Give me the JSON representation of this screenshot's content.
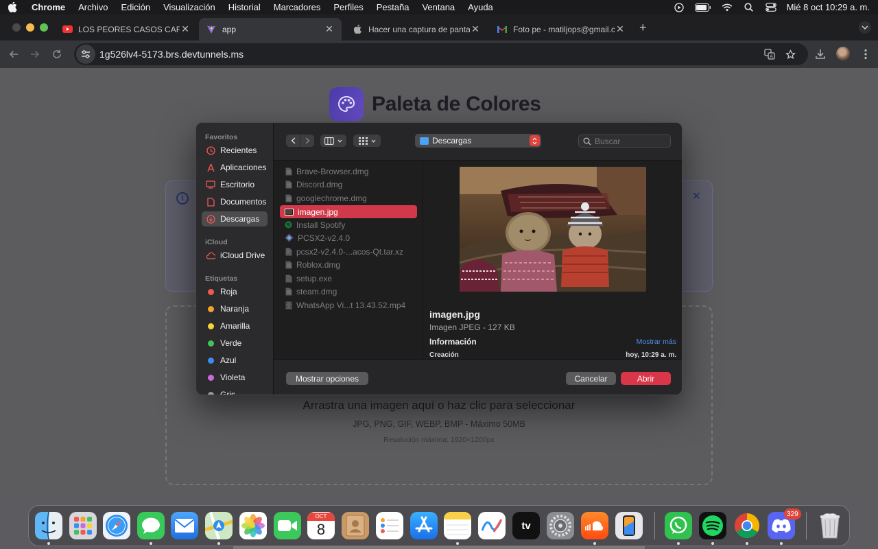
{
  "menubar": {
    "app": "Chrome",
    "items": [
      "Archivo",
      "Edición",
      "Visualización",
      "Historial",
      "Marcadores",
      "Perfiles",
      "Pestaña",
      "Ventana",
      "Ayuda"
    ],
    "clock": "Mié 8 oct 10:29 a. m."
  },
  "browser": {
    "tabs": [
      {
        "title": "LOS PEORES CASOS CAPTADOS",
        "icon": "youtube-icon"
      },
      {
        "title": "app",
        "icon": "vite-icon"
      },
      {
        "title": "Hacer una captura de pantalla",
        "icon": "apple-icon"
      },
      {
        "title": "Foto pe - matiljops@gmail.com",
        "icon": "gmail-icon"
      }
    ],
    "active_tab": 1,
    "url": "1g526lv4-5173.brs.devtunnels.ms"
  },
  "page": {
    "title": "Paleta de Colores",
    "dropzone_title": "Arrastra una imagen aquí o haz clic para seleccionar",
    "dropzone_formats": "JPG, PNG, GIF, WEBP, BMP - Máximo 50MB",
    "dropzone_note": "Resolución máxima: 1920×1200px"
  },
  "dialog": {
    "sidebar": {
      "favorites_label": "Favoritos",
      "favorites": [
        "Recientes",
        "Aplicaciones",
        "Escritorio",
        "Documentos",
        "Descargas"
      ],
      "selected": "Descargas",
      "icloud_label": "iCloud",
      "icloud": [
        "iCloud Drive"
      ],
      "tags_label": "Etiquetas",
      "tags": [
        {
          "name": "Roja",
          "color": "#f05a55"
        },
        {
          "name": "Naranja",
          "color": "#f4a033"
        },
        {
          "name": "Amarilla",
          "color": "#f5d33a"
        },
        {
          "name": "Verde",
          "color": "#43c15a"
        },
        {
          "name": "Azul",
          "color": "#3b8ef0"
        },
        {
          "name": "Violeta",
          "color": "#c86ad8"
        },
        {
          "name": "Gris",
          "color": "#9a9a9c"
        }
      ]
    },
    "location": "Descargas",
    "search_placeholder": "Buscar",
    "files": [
      {
        "name": "Brave-Browser.dmg",
        "icon": "disk-image-icon"
      },
      {
        "name": "Discord.dmg",
        "icon": "disk-image-icon"
      },
      {
        "name": "googlechrome.dmg",
        "icon": "disk-image-icon"
      },
      {
        "name": "imagen.jpg",
        "icon": "image-file-icon",
        "selected": true
      },
      {
        "name": "Install Spotify",
        "icon": "spotify-icon"
      },
      {
        "name": "PCSX2-v2.4.0",
        "icon": "app-icon"
      },
      {
        "name": "pcsx2-v2.4.0-...acos-Qt.tar.xz",
        "icon": "archive-icon"
      },
      {
        "name": "Roblox.dmg",
        "icon": "disk-image-icon"
      },
      {
        "name": "setup.exe",
        "icon": "document-icon"
      },
      {
        "name": "steam.dmg",
        "icon": "disk-image-icon"
      },
      {
        "name": "WhatsApp Vi...t 13.43.52.mp4",
        "icon": "video-file-icon"
      }
    ],
    "preview": {
      "name": "imagen.jpg",
      "kind": "Imagen JPEG - 127 KB",
      "info_label": "Información",
      "more_label": "Mostrar más",
      "created_label": "Creación",
      "created_value": "hoy, 10:29 a. m."
    },
    "buttons": {
      "options": "Mostrar opciones",
      "cancel": "Cancelar",
      "open": "Abrir"
    }
  },
  "dock": {
    "apps": [
      "Finder",
      "Launchpad",
      "Safari",
      "Mensajes",
      "Mail",
      "Mapas",
      "Fotos",
      "FaceTime",
      "Calendario",
      "Contactos",
      "Recordatorios",
      "App Store",
      "Notas",
      "Freeform",
      "TV",
      "Configuración del Sistema",
      "SoundCloud",
      "iPhone Mirroring",
      "WhatsApp",
      "Spotify",
      "Google Chrome",
      "Discord",
      "Papelera"
    ],
    "calendar_month": "OCT",
    "calendar_day": "8",
    "tv_label": "tv",
    "discord_badge": "329"
  }
}
